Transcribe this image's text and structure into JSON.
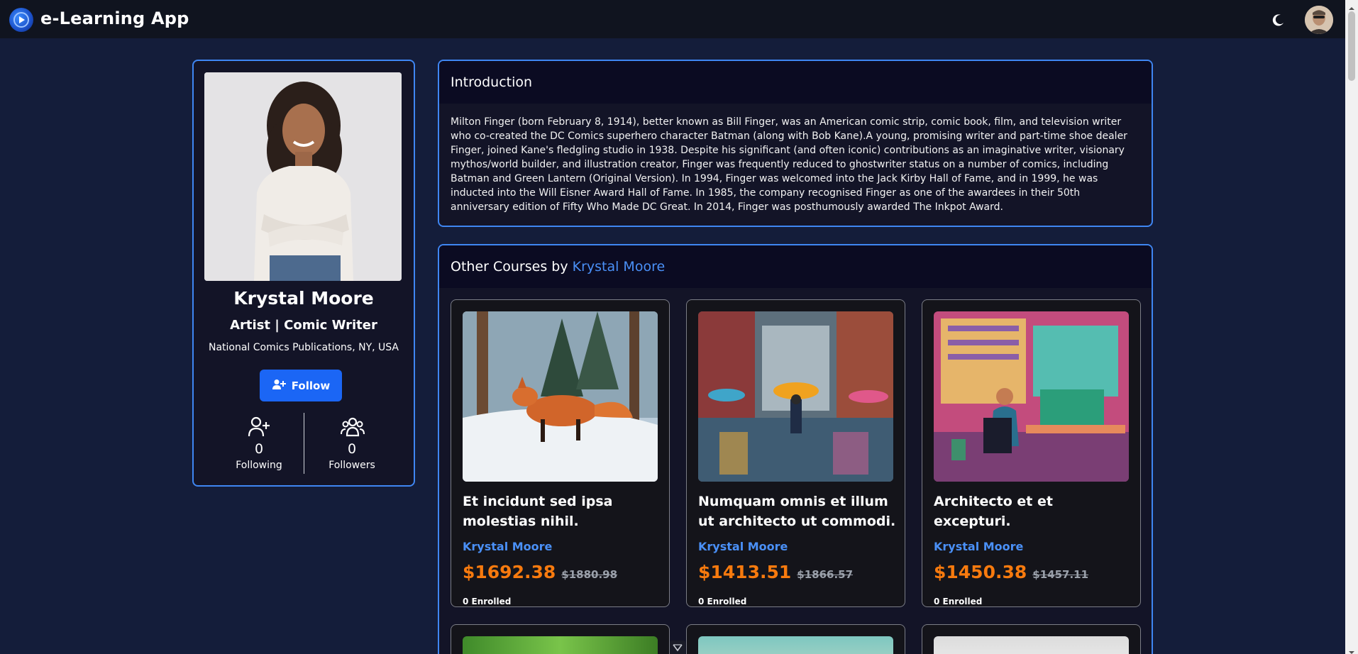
{
  "app": {
    "title": "e-Learning App"
  },
  "profile": {
    "name": "Krystal Moore",
    "role": "Artist | Comic Writer",
    "organization": "National Comics Publications, NY, USA",
    "follow_label": "Follow",
    "following_count": "0",
    "following_label": "Following",
    "followers_count": "0",
    "followers_label": "Followers"
  },
  "intro": {
    "title": "Introduction",
    "text": "Milton Finger (born February 8, 1914), better known as Bill Finger, was an American comic strip, comic book, film, and television writer who co-created the DC Comics superhero character Batman (along with Bob Kane).A young, promising writer and part-time shoe dealer Finger, joined Kane's fledgling studio in 1938. Despite his significant (and often iconic) contributions as an imaginative writer, visionary mythos/world builder, and illustration creator, Finger was frequently reduced to ghostwriter status on a number of comics, including Batman and Green Lantern (Original Version). In 1994, Finger was welcomed into the Jack Kirby Hall of Fame, and in 1999, he was inducted into the Will Eisner Award Hall of Fame. In 1985, the company recognised Finger as one of the awardees in their 50th anniversary edition of Fifty Who Made DC Great. In 2014, Finger was posthumously awarded The Inkpot Award."
  },
  "courses": {
    "header_prefix": "Other Courses by ",
    "header_author": "Krystal Moore",
    "items": [
      {
        "title": "Et incidunt sed ipsa molestias nihil.",
        "author": "Krystal Moore",
        "price": "$1692.38",
        "old_price": "$1880.98",
        "enrolled": "0 Enrolled"
      },
      {
        "title": "Numquam omnis et illum ut architecto ut commodi.",
        "author": "Krystal Moore",
        "price": "$1413.51",
        "old_price": "$1866.57",
        "enrolled": "0 Enrolled"
      },
      {
        "title": "Architecto et et excepturi.",
        "author": "Krystal Moore",
        "price": "$1450.38",
        "old_price": "$1457.11",
        "enrolled": "0 Enrolled"
      }
    ]
  },
  "colors": {
    "background": "#141d3a",
    "topbar": "#10141f",
    "accent": "#3f86f2",
    "button": "#1b66f5",
    "price": "#f77a0e"
  },
  "icons": [
    "logo-icon",
    "moon-icon",
    "user-plus-icon",
    "users-icon"
  ]
}
